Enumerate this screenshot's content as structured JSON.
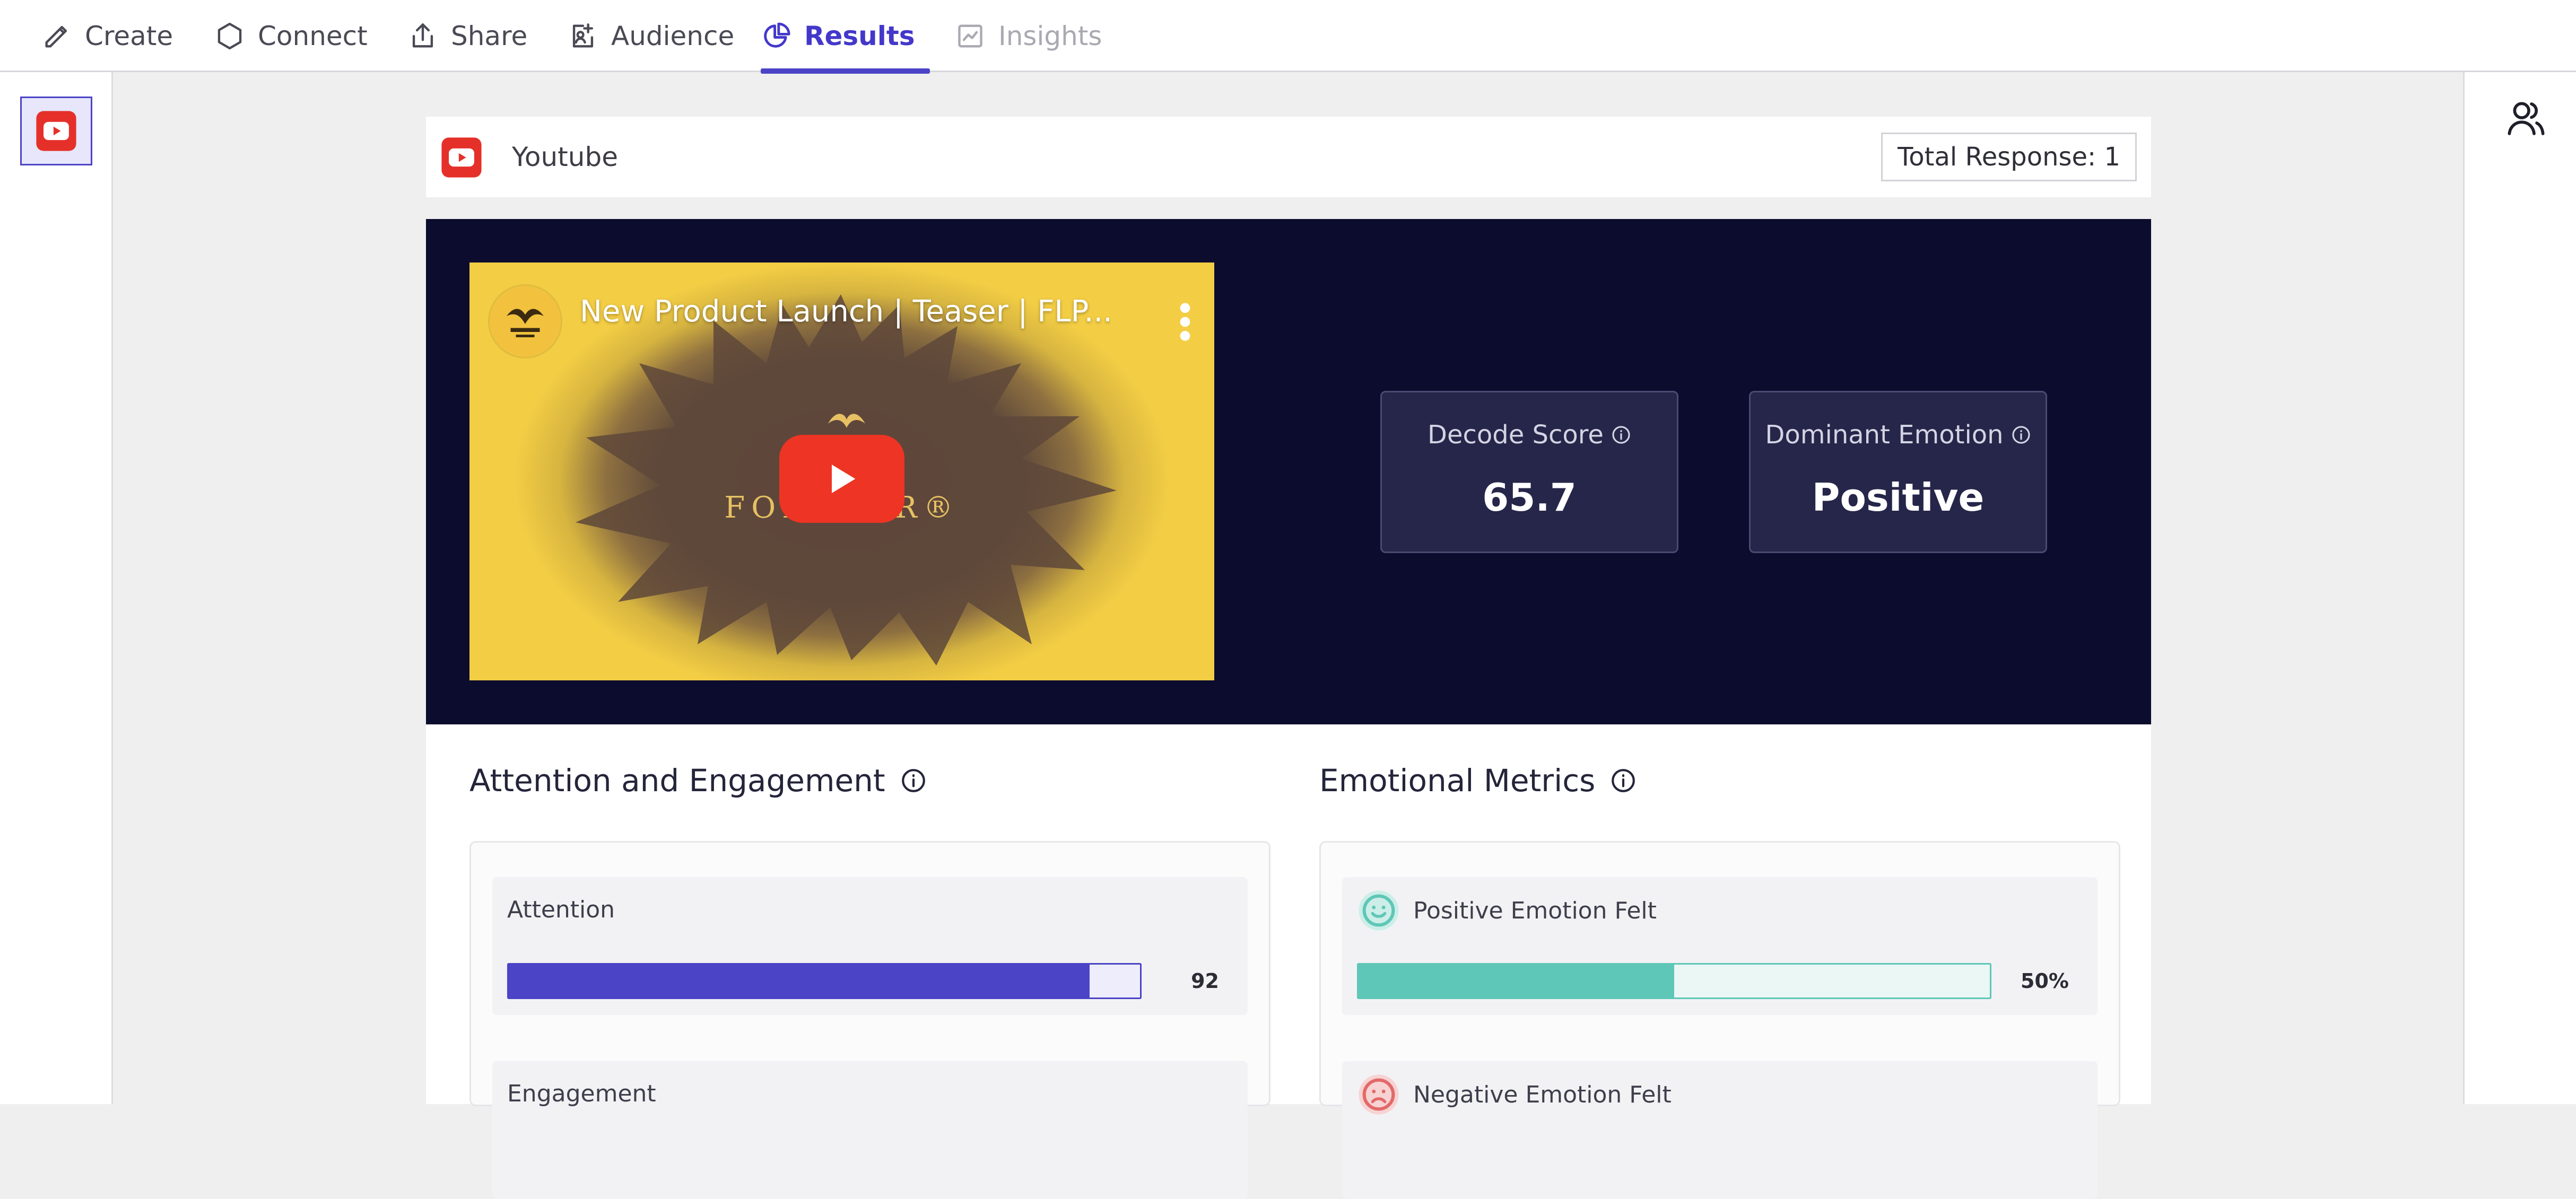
{
  "nav": {
    "tabs": [
      {
        "label": "Create",
        "icon": "pencil-icon",
        "state": "normal"
      },
      {
        "label": "Connect",
        "icon": "hexagon-icon",
        "state": "normal"
      },
      {
        "label": "Share",
        "icon": "share-icon",
        "state": "normal"
      },
      {
        "label": "Audience",
        "icon": "audience-icon",
        "state": "normal"
      },
      {
        "label": "Results",
        "icon": "pie-chart-icon",
        "state": "active"
      },
      {
        "label": "Insights",
        "icon": "line-chart-icon",
        "state": "disabled"
      }
    ],
    "accent_color": "#4b44c6"
  },
  "left_rail": {
    "items": [
      {
        "icon": "youtube-icon",
        "selected": true
      }
    ]
  },
  "right_rail": {
    "icon": "people-icon"
  },
  "source": {
    "icon": "youtube-icon",
    "title": "Youtube",
    "total_response": "Total Response: 1"
  },
  "video": {
    "title": "New Product Launch | Teaser | FLP...",
    "brand_text": "FOREVER®",
    "channel_avatar_icon": "eagle-logo-icon",
    "play_icon": "play-icon",
    "menu_icon": "kebab-menu-icon"
  },
  "scores": {
    "decode": {
      "label": "Decode Score",
      "value": "65.7"
    },
    "emotion": {
      "label": "Dominant Emotion",
      "value": "Positive"
    }
  },
  "attention": {
    "title": "Attention and Engagement",
    "metrics": [
      {
        "label": "Attention",
        "value": 92,
        "display": "92",
        "color": "#4b44c6"
      },
      {
        "label": "Engagement"
      }
    ]
  },
  "emotional": {
    "title": "Emotional Metrics",
    "metrics": [
      {
        "label": "Positive Emotion Felt",
        "value": 50,
        "display": "50%",
        "color": "#5fc7b7",
        "icon": "smile-icon"
      },
      {
        "label": "Negative Emotion Felt",
        "color": "#e26a6a",
        "icon": "frown-icon"
      }
    ]
  }
}
